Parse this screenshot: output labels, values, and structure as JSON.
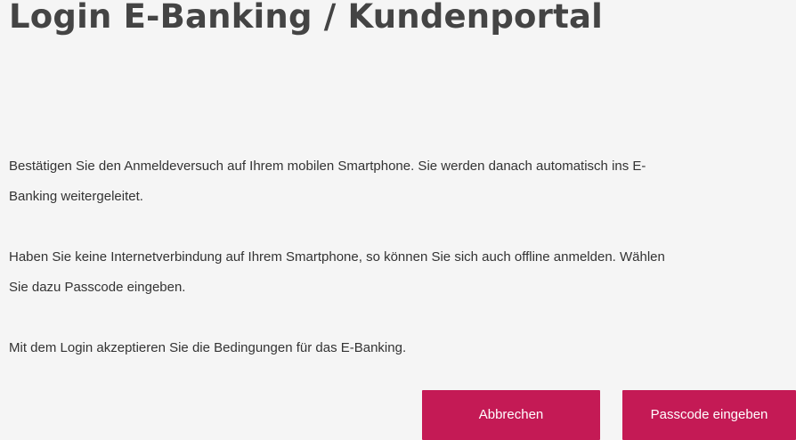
{
  "header": {
    "title": "Login E-Banking / Kundenportal"
  },
  "main": {
    "paragraphs": [
      {
        "line1": "Bestätigen Sie den Anmeldeversuch auf Ihrem mobilen Smartphone. Sie werden danach automatisch ins E-",
        "line2": "Banking weitergeleitet."
      },
      {
        "line1": "Haben Sie keine Internetverbindung auf Ihrem Smartphone, so können Sie sich auch offline anmelden. Wählen",
        "line2": "Sie dazu Passcode eingeben."
      },
      {
        "line1": "Mit dem Login akzeptieren Sie die Bedingungen für das E-Banking."
      }
    ]
  },
  "actions": {
    "cancel_label": "Abbrechen",
    "passcode_label": "Passcode eingeben"
  },
  "colors": {
    "accent": "#c41a55",
    "background": "#f5f5f5",
    "title": "#444444",
    "text": "#333333"
  }
}
